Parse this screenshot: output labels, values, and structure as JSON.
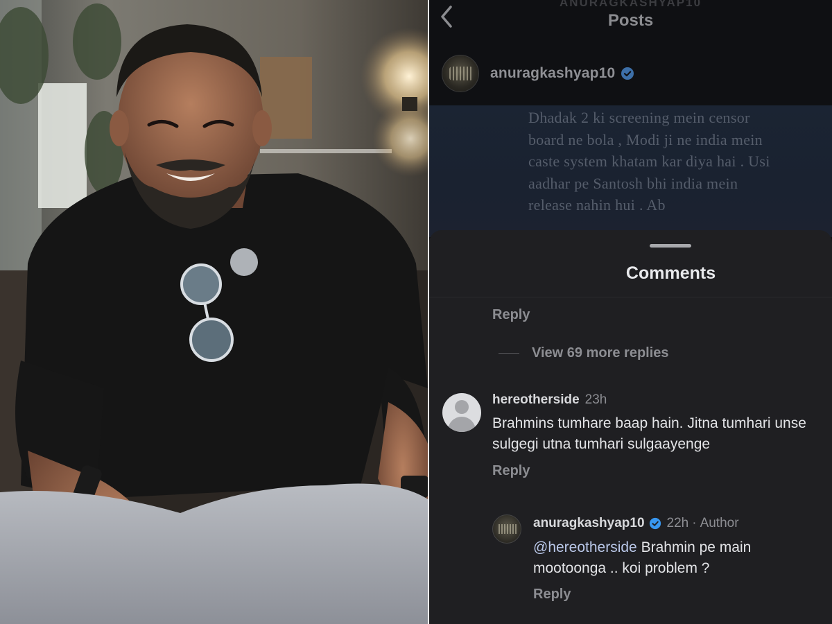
{
  "header": {
    "super_title": "ANURAGKASHYAP10",
    "title": "Posts"
  },
  "post": {
    "username": "anuragkashyap10",
    "text": "Dhadak 2 ki screening mein censor board ne bola , Modi ji ne india mein caste system khatam kar diya hai . Usi aadhar pe Santosh bhi india mein release nahin hui . Ab"
  },
  "comments": {
    "title": "Comments",
    "top_reply_label": "Reply",
    "view_more": "View 69 more replies",
    "items": [
      {
        "username": "hereotherside",
        "time": "23h",
        "text": "Brahmins tumhare baap hain. Jitna tumhari unse sulgegi utna tumhari sulgaayenge",
        "reply_label": "Reply"
      },
      {
        "username": "anuragkashyap10",
        "time": "22h",
        "separator": "·",
        "tag": "Author",
        "mention": "@hereotherside",
        "text": " Brahmin pe main mootoonga .. koi problem ?",
        "reply_label": "Reply"
      }
    ]
  },
  "colors": {
    "verified": "#3897f0",
    "sheet_bg": "#1f1f22",
    "post_bg": "#1b2433"
  },
  "icons": {
    "back": "chevron-left-icon",
    "verified": "verified-badge-icon",
    "default_avatar": "default-user-icon"
  }
}
